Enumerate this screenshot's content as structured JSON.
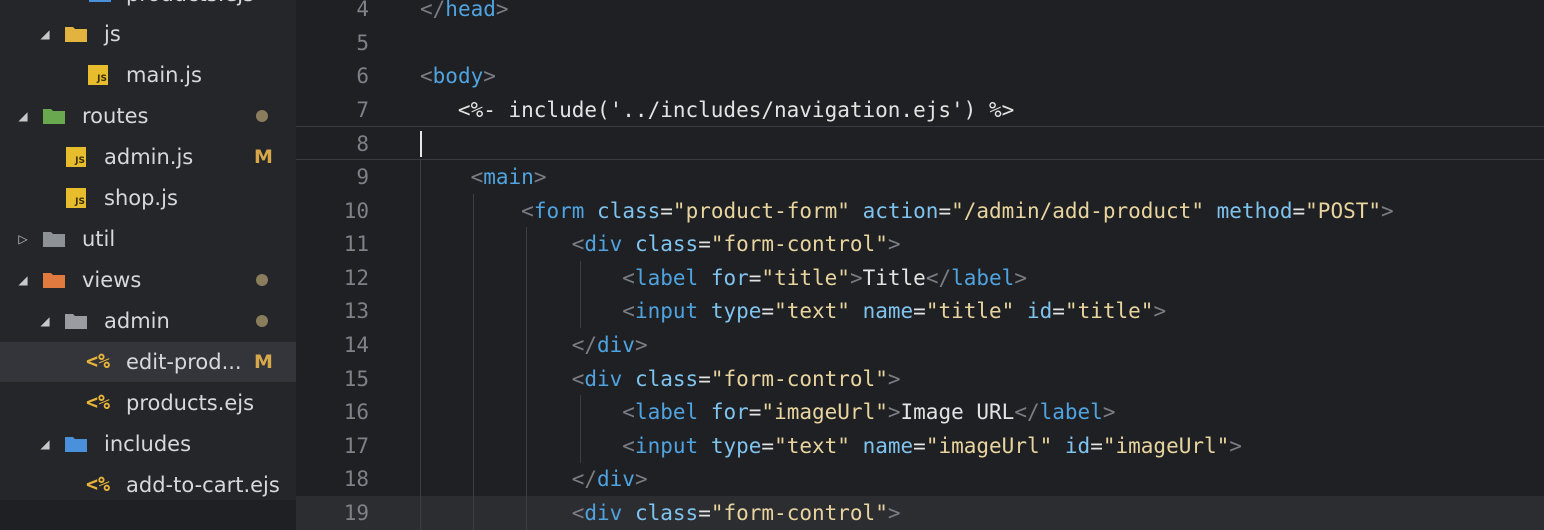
{
  "explorer": {
    "rows": [
      {
        "label": "products.ejs",
        "icon": "node-folder-icon",
        "arrow": "",
        "status": "",
        "partial": true
      },
      {
        "label": "js",
        "icon": "yellow-folder-icon",
        "arrow": "expanded",
        "status": ""
      },
      {
        "label": "main.js",
        "icon": "js-file-icon",
        "arrow": "",
        "status": ""
      },
      {
        "label": "routes",
        "icon": "green-folder-icon",
        "arrow": "expanded",
        "status": "dot"
      },
      {
        "label": "admin.js",
        "icon": "js-file-icon",
        "arrow": "",
        "status": "M"
      },
      {
        "label": "shop.js",
        "icon": "js-file-icon",
        "arrow": "",
        "status": ""
      },
      {
        "label": "util",
        "icon": "grey-folder-icon",
        "arrow": "collapsed",
        "status": ""
      },
      {
        "label": "views",
        "icon": "orange-folder-icon",
        "arrow": "expanded",
        "status": "dot"
      },
      {
        "label": "admin",
        "icon": "grey-open-folder-icon",
        "arrow": "expanded",
        "status": "dot"
      },
      {
        "label": "edit-prod...",
        "icon": "ejs-file-icon",
        "arrow": "",
        "status": "M",
        "selected": true
      },
      {
        "label": "products.ejs",
        "icon": "ejs-file-icon",
        "arrow": "",
        "status": ""
      },
      {
        "label": "includes",
        "icon": "blue-folder-icon",
        "arrow": "expanded",
        "status": ""
      },
      {
        "label": "add-to-cart.ejs",
        "icon": "ejs-file-icon",
        "arrow": "",
        "status": ""
      }
    ],
    "status_m": "M",
    "ejs_glyph": "<%",
    "js_badge": "JS"
  },
  "editor": {
    "lines": [
      {
        "num": "4",
        "tokens": [
          {
            "c": "punc",
            "t": "</"
          },
          {
            "c": "tag",
            "t": "head"
          },
          {
            "c": "punc",
            "t": ">"
          }
        ]
      },
      {
        "num": "5",
        "tokens": []
      },
      {
        "num": "6",
        "tokens": [
          {
            "c": "punc",
            "t": "<"
          },
          {
            "c": "tag",
            "t": "body"
          },
          {
            "c": "punc",
            "t": ">"
          }
        ]
      },
      {
        "num": "7",
        "tokens": [
          {
            "c": "txt",
            "t": "   <%- include('../includes/navigation.ejs') %>"
          }
        ]
      },
      {
        "num": "8",
        "tokens": [],
        "current": true
      },
      {
        "num": "9",
        "tokens": [
          {
            "c": "txt",
            "t": "    "
          },
          {
            "c": "punc",
            "t": "<"
          },
          {
            "c": "tag",
            "t": "main"
          },
          {
            "c": "punc",
            "t": ">"
          }
        ]
      },
      {
        "num": "10",
        "tokens": [
          {
            "c": "txt",
            "t": "        "
          },
          {
            "c": "punc",
            "t": "<"
          },
          {
            "c": "tag",
            "t": "form"
          },
          {
            "c": "txt",
            "t": " "
          },
          {
            "c": "attr",
            "t": "class"
          },
          {
            "c": "txt",
            "t": "="
          },
          {
            "c": "str",
            "t": "\"product-form\""
          },
          {
            "c": "txt",
            "t": " "
          },
          {
            "c": "attr",
            "t": "action"
          },
          {
            "c": "txt",
            "t": "="
          },
          {
            "c": "str",
            "t": "\"/admin/add-product\""
          },
          {
            "c": "txt",
            "t": " "
          },
          {
            "c": "attr",
            "t": "method"
          },
          {
            "c": "txt",
            "t": "="
          },
          {
            "c": "str",
            "t": "\"POST\""
          },
          {
            "c": "punc",
            "t": ">"
          }
        ]
      },
      {
        "num": "11",
        "tokens": [
          {
            "c": "txt",
            "t": "            "
          },
          {
            "c": "punc",
            "t": "<"
          },
          {
            "c": "tag",
            "t": "div"
          },
          {
            "c": "txt",
            "t": " "
          },
          {
            "c": "attr",
            "t": "class"
          },
          {
            "c": "txt",
            "t": "="
          },
          {
            "c": "str",
            "t": "\"form-control\""
          },
          {
            "c": "punc",
            "t": ">"
          }
        ]
      },
      {
        "num": "12",
        "tokens": [
          {
            "c": "txt",
            "t": "                "
          },
          {
            "c": "punc",
            "t": "<"
          },
          {
            "c": "tag",
            "t": "label"
          },
          {
            "c": "txt",
            "t": " "
          },
          {
            "c": "attr",
            "t": "for"
          },
          {
            "c": "txt",
            "t": "="
          },
          {
            "c": "str",
            "t": "\"title\""
          },
          {
            "c": "punc",
            "t": ">"
          },
          {
            "c": "txt",
            "t": "Title"
          },
          {
            "c": "punc",
            "t": "</"
          },
          {
            "c": "tag",
            "t": "label"
          },
          {
            "c": "punc",
            "t": ">"
          }
        ]
      },
      {
        "num": "13",
        "tokens": [
          {
            "c": "txt",
            "t": "                "
          },
          {
            "c": "punc",
            "t": "<"
          },
          {
            "c": "tag",
            "t": "input"
          },
          {
            "c": "txt",
            "t": " "
          },
          {
            "c": "attr",
            "t": "type"
          },
          {
            "c": "txt",
            "t": "="
          },
          {
            "c": "str",
            "t": "\"text\""
          },
          {
            "c": "txt",
            "t": " "
          },
          {
            "c": "attr",
            "t": "name"
          },
          {
            "c": "txt",
            "t": "="
          },
          {
            "c": "str",
            "t": "\"title\""
          },
          {
            "c": "txt",
            "t": " "
          },
          {
            "c": "attr",
            "t": "id"
          },
          {
            "c": "txt",
            "t": "="
          },
          {
            "c": "str",
            "t": "\"title\""
          },
          {
            "c": "punc",
            "t": ">"
          }
        ]
      },
      {
        "num": "14",
        "tokens": [
          {
            "c": "txt",
            "t": "            "
          },
          {
            "c": "punc",
            "t": "</"
          },
          {
            "c": "tag",
            "t": "div"
          },
          {
            "c": "punc",
            "t": ">"
          }
        ]
      },
      {
        "num": "15",
        "tokens": [
          {
            "c": "txt",
            "t": "            "
          },
          {
            "c": "punc",
            "t": "<"
          },
          {
            "c": "tag",
            "t": "div"
          },
          {
            "c": "txt",
            "t": " "
          },
          {
            "c": "attr",
            "t": "class"
          },
          {
            "c": "txt",
            "t": "="
          },
          {
            "c": "str",
            "t": "\"form-control\""
          },
          {
            "c": "punc",
            "t": ">"
          }
        ]
      },
      {
        "num": "16",
        "tokens": [
          {
            "c": "txt",
            "t": "                "
          },
          {
            "c": "punc",
            "t": "<"
          },
          {
            "c": "tag",
            "t": "label"
          },
          {
            "c": "txt",
            "t": " "
          },
          {
            "c": "attr",
            "t": "for"
          },
          {
            "c": "txt",
            "t": "="
          },
          {
            "c": "str",
            "t": "\"imageUrl\""
          },
          {
            "c": "punc",
            "t": ">"
          },
          {
            "c": "txt",
            "t": "Image URL"
          },
          {
            "c": "punc",
            "t": "</"
          },
          {
            "c": "tag",
            "t": "label"
          },
          {
            "c": "punc",
            "t": ">"
          }
        ]
      },
      {
        "num": "17",
        "tokens": [
          {
            "c": "txt",
            "t": "                "
          },
          {
            "c": "punc",
            "t": "<"
          },
          {
            "c": "tag",
            "t": "input"
          },
          {
            "c": "txt",
            "t": " "
          },
          {
            "c": "attr",
            "t": "type"
          },
          {
            "c": "txt",
            "t": "="
          },
          {
            "c": "str",
            "t": "\"text\""
          },
          {
            "c": "txt",
            "t": " "
          },
          {
            "c": "attr",
            "t": "name"
          },
          {
            "c": "txt",
            "t": "="
          },
          {
            "c": "str",
            "t": "\"imageUrl\""
          },
          {
            "c": "txt",
            "t": " "
          },
          {
            "c": "attr",
            "t": "id"
          },
          {
            "c": "txt",
            "t": "="
          },
          {
            "c": "str",
            "t": "\"imageUrl\""
          },
          {
            "c": "punc",
            "t": ">"
          }
        ]
      },
      {
        "num": "18",
        "tokens": [
          {
            "c": "txt",
            "t": "            "
          },
          {
            "c": "punc",
            "t": "</"
          },
          {
            "c": "tag",
            "t": "div"
          },
          {
            "c": "punc",
            "t": ">"
          }
        ]
      },
      {
        "num": "19",
        "tokens": [
          {
            "c": "txt",
            "t": "            "
          },
          {
            "c": "punc",
            "t": "<"
          },
          {
            "c": "tag",
            "t": "div"
          },
          {
            "c": "txt",
            "t": " "
          },
          {
            "c": "attr",
            "t": "class"
          },
          {
            "c": "txt",
            "t": "="
          },
          {
            "c": "str",
            "t": "\"form-control\""
          },
          {
            "c": "punc",
            "t": ">"
          }
        ],
        "highlight": true
      }
    ]
  },
  "colors": {
    "sidebar_bg": "#25262a",
    "editor_bg": "#1f2023",
    "tag": "#4fa3e0",
    "attr": "#7fc3ef",
    "string": "#e8d49e",
    "modified": "#d6a84a"
  }
}
